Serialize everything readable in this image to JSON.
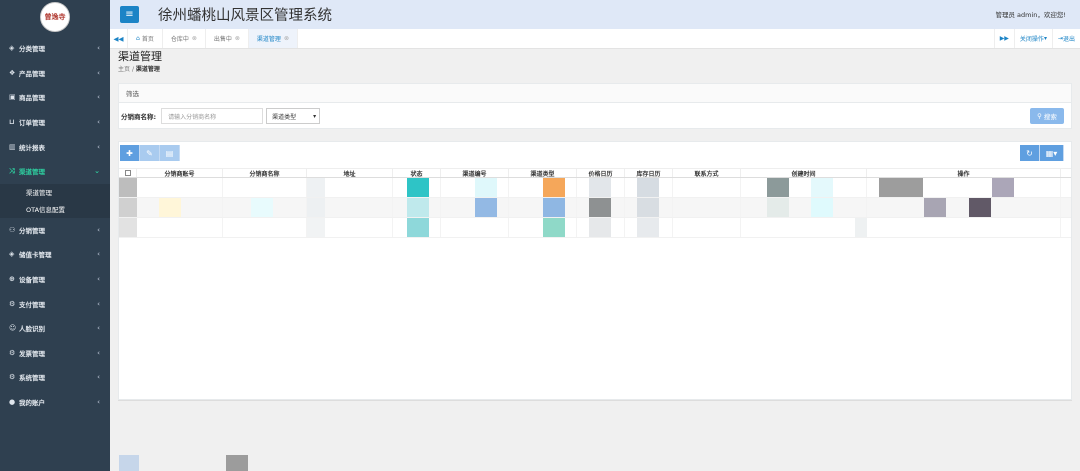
{
  "sidebar": {
    "logo_text": "曾逸寺",
    "items": [
      {
        "label": "分类管理",
        "icon": "tag-icon"
      },
      {
        "label": "产品管理",
        "icon": "cubes-icon"
      },
      {
        "label": "商品管理",
        "icon": "cube-icon"
      },
      {
        "label": "订单管理",
        "icon": "cart-icon"
      },
      {
        "label": "统计报表",
        "icon": "chart-icon"
      },
      {
        "label": "渠道管理",
        "icon": "random-icon",
        "active": true
      },
      {
        "label": "分销管理",
        "icon": "share-icon"
      },
      {
        "label": "储值卡管理",
        "icon": "card-icon"
      },
      {
        "label": "设备管理",
        "icon": "device-icon"
      },
      {
        "label": "支付管理",
        "icon": "cogs-icon"
      },
      {
        "label": "人脸识别",
        "icon": "face-icon"
      },
      {
        "label": "发票管理",
        "icon": "invoice-icon"
      },
      {
        "label": "系统管理",
        "icon": "settings-icon"
      },
      {
        "label": "我的账户",
        "icon": "user-icon"
      }
    ],
    "submenu": [
      "渠道管理",
      "OTA信息配置"
    ]
  },
  "header": {
    "title": "徐州蟠桃山风景区管理系统",
    "welcome": "管理员 admin，欢迎您!"
  },
  "tabs": {
    "items": [
      "首页",
      "仓库中",
      "出售中",
      "渠道管理"
    ],
    "close_actions": "关闭操作",
    "logout": "退出"
  },
  "page": {
    "title": "渠道管理",
    "breadcrumb_home": "主页",
    "breadcrumb_current": "渠道管理"
  },
  "filter": {
    "heading": "筛选",
    "label": "分销商名称:",
    "placeholder": "请输入分销商名称",
    "select_value": "渠道类型",
    "search_label": "搜索"
  },
  "table": {
    "columns": [
      "分销商账号",
      "分销商名称",
      "地址",
      "状态",
      "渠道编号",
      "渠道类型",
      "价格日历",
      "库存日历",
      "联系方式",
      "创建时间",
      "操作"
    ]
  },
  "colors": {
    "sidebar_bg": "#2f4050",
    "active_menu": "#2ecfa0",
    "primary": "#1c84c6",
    "header_bg": "#dfe8f7"
  }
}
